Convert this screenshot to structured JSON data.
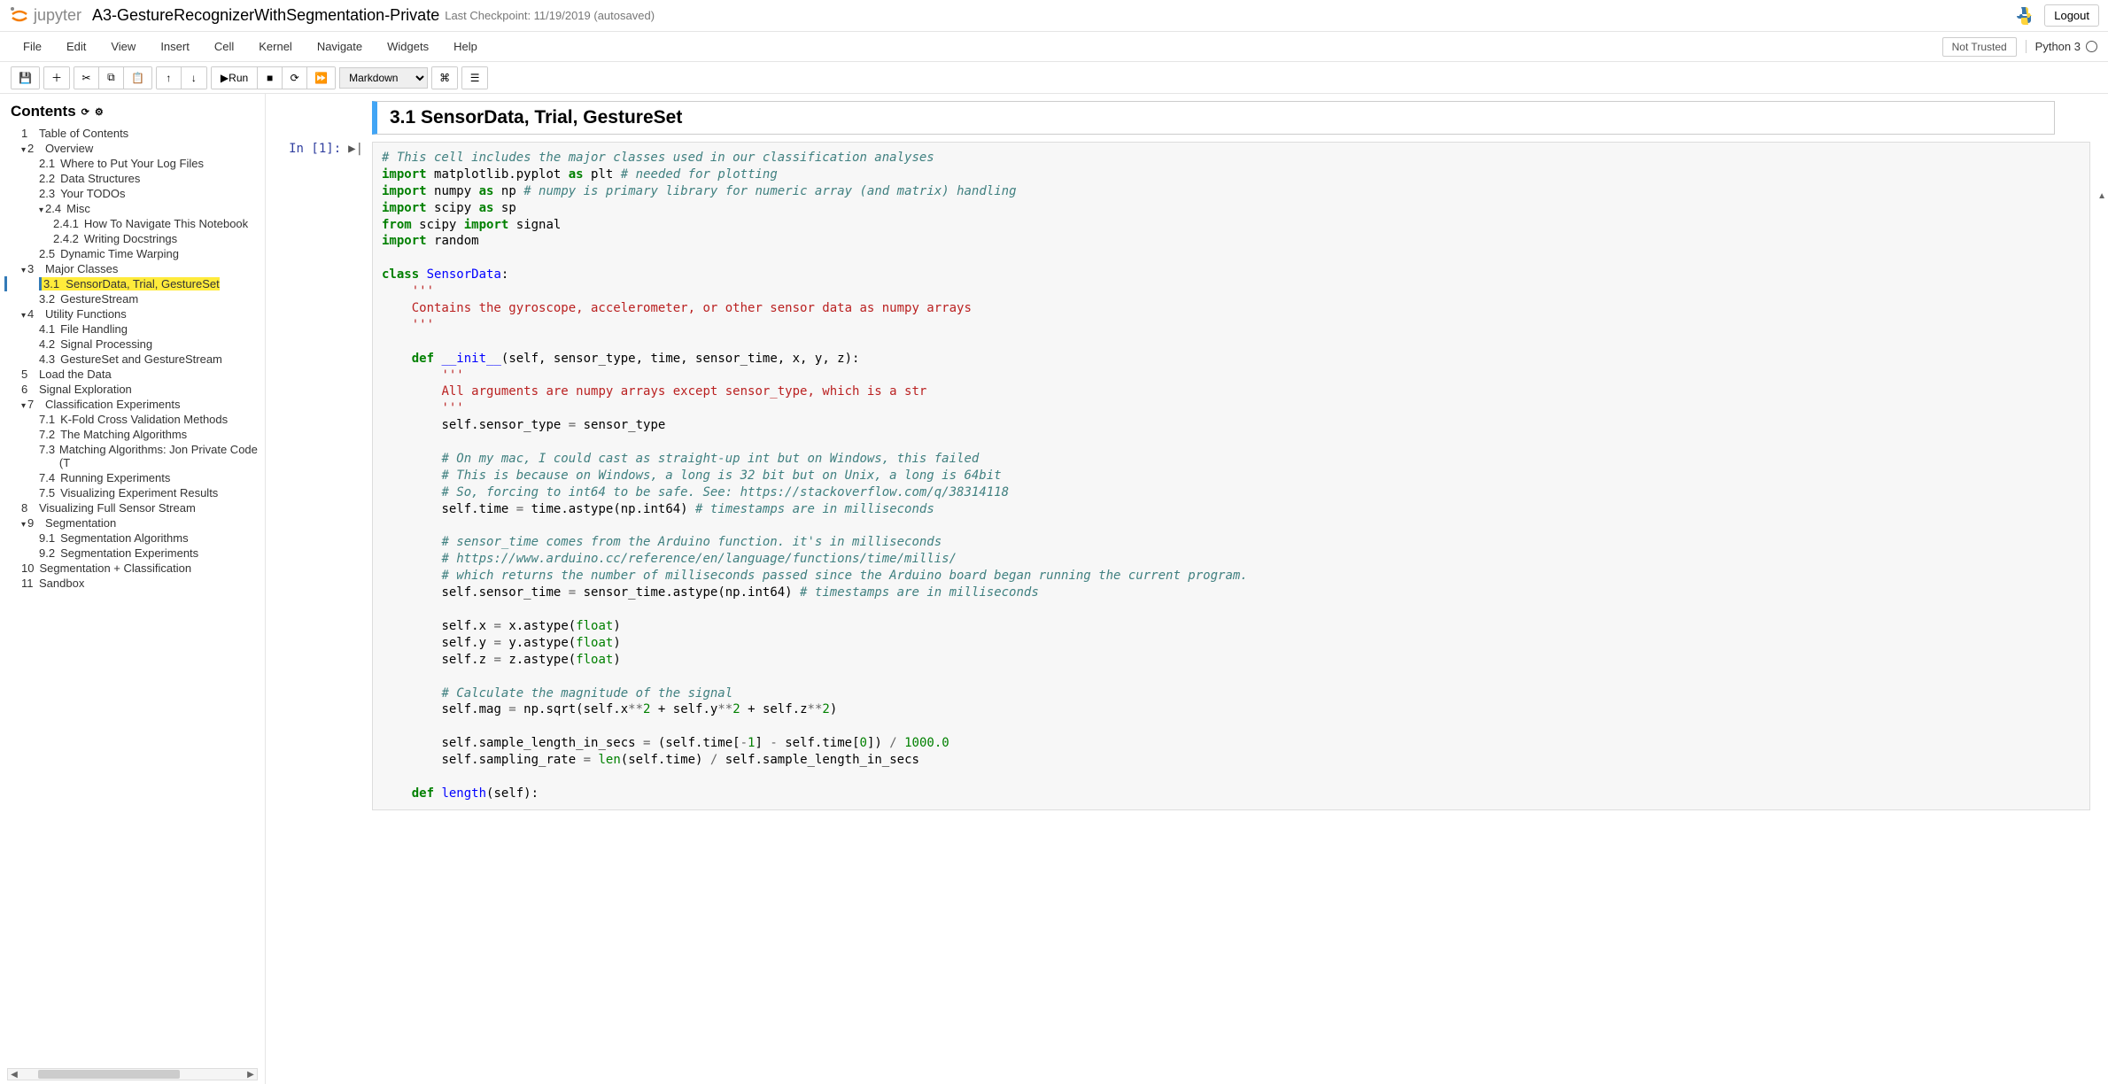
{
  "header": {
    "logo_text": "jupyter",
    "title": "A3-GestureRecognizerWithSegmentation-Private",
    "checkpoint": "Last Checkpoint: 11/19/2019  (autosaved)",
    "logout": "Logout"
  },
  "menubar": {
    "items": [
      "File",
      "Edit",
      "View",
      "Insert",
      "Cell",
      "Kernel",
      "Navigate",
      "Widgets",
      "Help"
    ],
    "trust": "Not Trusted",
    "kernel": "Python 3"
  },
  "toolbar": {
    "run_label": "Run",
    "cell_type": "Markdown"
  },
  "sidebar": {
    "title": "Contents",
    "items": [
      {
        "num": "1",
        "label": "Table of Contents",
        "lvl": 1
      },
      {
        "num": "2",
        "label": "Overview",
        "lvl": 1,
        "caret": true
      },
      {
        "num": "2.1",
        "label": "Where to Put Your Log Files",
        "lvl": 2
      },
      {
        "num": "2.2",
        "label": "Data Structures",
        "lvl": 2
      },
      {
        "num": "2.3",
        "label": "Your TODOs",
        "lvl": 2
      },
      {
        "num": "2.4",
        "label": "Misc",
        "lvl": 2,
        "caret": true
      },
      {
        "num": "2.4.1",
        "label": "How To Navigate This Notebook",
        "lvl": 3
      },
      {
        "num": "2.4.2",
        "label": "Writing Docstrings",
        "lvl": 3
      },
      {
        "num": "2.5",
        "label": "Dynamic Time Warping",
        "lvl": 2
      },
      {
        "num": "3",
        "label": "Major Classes",
        "lvl": 1,
        "caret": true
      },
      {
        "num": "3.1",
        "label": "SensorData, Trial, GestureSet",
        "lvl": 2,
        "active": true
      },
      {
        "num": "3.2",
        "label": "GestureStream",
        "lvl": 2
      },
      {
        "num": "4",
        "label": "Utility Functions",
        "lvl": 1,
        "caret": true
      },
      {
        "num": "4.1",
        "label": "File Handling",
        "lvl": 2
      },
      {
        "num": "4.2",
        "label": "Signal Processing",
        "lvl": 2
      },
      {
        "num": "4.3",
        "label": "GestureSet and GestureStream",
        "lvl": 2
      },
      {
        "num": "5",
        "label": "Load the Data",
        "lvl": 1
      },
      {
        "num": "6",
        "label": "Signal Exploration",
        "lvl": 1
      },
      {
        "num": "7",
        "label": "Classification Experiments",
        "lvl": 1,
        "caret": true
      },
      {
        "num": "7.1",
        "label": "K-Fold Cross Validation Methods",
        "lvl": 2
      },
      {
        "num": "7.2",
        "label": "The Matching Algorithms",
        "lvl": 2
      },
      {
        "num": "7.3",
        "label": "Matching Algorithms: Jon Private Code (T",
        "lvl": 2
      },
      {
        "num": "7.4",
        "label": "Running Experiments",
        "lvl": 2
      },
      {
        "num": "7.5",
        "label": "Visualizing Experiment Results",
        "lvl": 2
      },
      {
        "num": "8",
        "label": "Visualizing Full Sensor Stream",
        "lvl": 1
      },
      {
        "num": "9",
        "label": "Segmentation",
        "lvl": 1,
        "caret": true
      },
      {
        "num": "9.1",
        "label": "Segmentation Algorithms",
        "lvl": 2
      },
      {
        "num": "9.2",
        "label": "Segmentation Experiments",
        "lvl": 2
      },
      {
        "num": "10",
        "label": "Segmentation + Classification",
        "lvl": 1
      },
      {
        "num": "11",
        "label": "Sandbox",
        "lvl": 1
      }
    ]
  },
  "main": {
    "heading": "3.1  SensorData, Trial, GestureSet",
    "prompt": "In [1]:",
    "code": {
      "l1c": "# This cell includes the major classes used in our classification analyses",
      "l2a": "import",
      "l2b": "matplotlib.pyplot",
      "l2c": "as",
      "l2d": "plt",
      "l2e": "# needed for plotting",
      "l3a": "import",
      "l3b": "numpy",
      "l3c": "as",
      "l3d": "np",
      "l3e": "# numpy is primary library for numeric array (and matrix) handling",
      "l4a": "import",
      "l4b": "scipy",
      "l4c": "as",
      "l4d": "sp",
      "l5a": "from",
      "l5b": "scipy",
      "l5c": "import",
      "l5d": "signal",
      "l6a": "import",
      "l6b": "random",
      "l7a": "class",
      "l7b": "SensorData",
      "l7c": ":",
      "l8": "'''",
      "l9": "Contains the gyroscope, accelerometer, or other sensor data as numpy arrays",
      "l10": "'''",
      "l11a": "def",
      "l11b": "__init__",
      "l11c": "(self, sensor_type, time, sensor_time, x, y, z):",
      "l12": "'''",
      "l13": "All arguments are numpy arrays except sensor_type, which is a str",
      "l14": "'''",
      "l15a": "self.sensor_type ",
      "l15b": "=",
      "l15c": " sensor_type",
      "l16": "# On my mac, I could cast as straight-up int but on Windows, this failed",
      "l17": "# This is because on Windows, a long is 32 bit but on Unix, a long is 64bit",
      "l18": "# So, forcing to int64 to be safe. See: https://stackoverflow.com/q/38314118",
      "l19a": "self.time ",
      "l19b": "=",
      "l19c": " time.astype(np.int64) ",
      "l19d": "# timestamps are in milliseconds",
      "l20": "# sensor_time comes from the Arduino function. it's in milliseconds",
      "l21": "# https://www.arduino.cc/reference/en/language/functions/time/millis/",
      "l22": "# which returns the number of milliseconds passed since the Arduino board began running the current program.",
      "l23a": "self.sensor_time ",
      "l23b": "=",
      "l23c": " sensor_time.astype(np.int64) ",
      "l23d": "# timestamps are in milliseconds",
      "l24a": "self.x ",
      "l24b": "=",
      "l24c": " x.astype(",
      "l24d": "float",
      "l24e": ")",
      "l25a": "self.y ",
      "l25b": "=",
      "l25c": " y.astype(",
      "l25d": "float",
      "l25e": ")",
      "l26a": "self.z ",
      "l26b": "=",
      "l26c": " z.astype(",
      "l26d": "float",
      "l26e": ")",
      "l27": "# Calculate the magnitude of the signal",
      "l28a": "self.mag ",
      "l28b": "=",
      "l28c": " np.sqrt(self.x",
      "l28d": "**",
      "l28e": "2",
      "l28f": " + ",
      "l28g": "self.y",
      "l28h": "**",
      "l28i": "2",
      "l28j": " + ",
      "l28k": "self.z",
      "l28l": "**",
      "l28m": "2",
      "l28n": ")",
      "l29a": "self.sample_length_in_secs ",
      "l29b": "=",
      "l29c": " (self.time[",
      "l29d": "-",
      "l29e": "1",
      "l29f": "] ",
      "l29g": "-",
      "l29h": " self.time[",
      "l29i": "0",
      "l29j": "]) ",
      "l29k": "/",
      "l29l": " ",
      "l29m": "1000.0",
      "l30a": "self.sampling_rate ",
      "l30b": "=",
      "l30c": " ",
      "l30d": "len",
      "l30e": "(self.time) ",
      "l30f": "/",
      "l30g": " self.sample_length_in_secs",
      "l31a": "def",
      "l31b": "length",
      "l31c": "(self):"
    }
  }
}
